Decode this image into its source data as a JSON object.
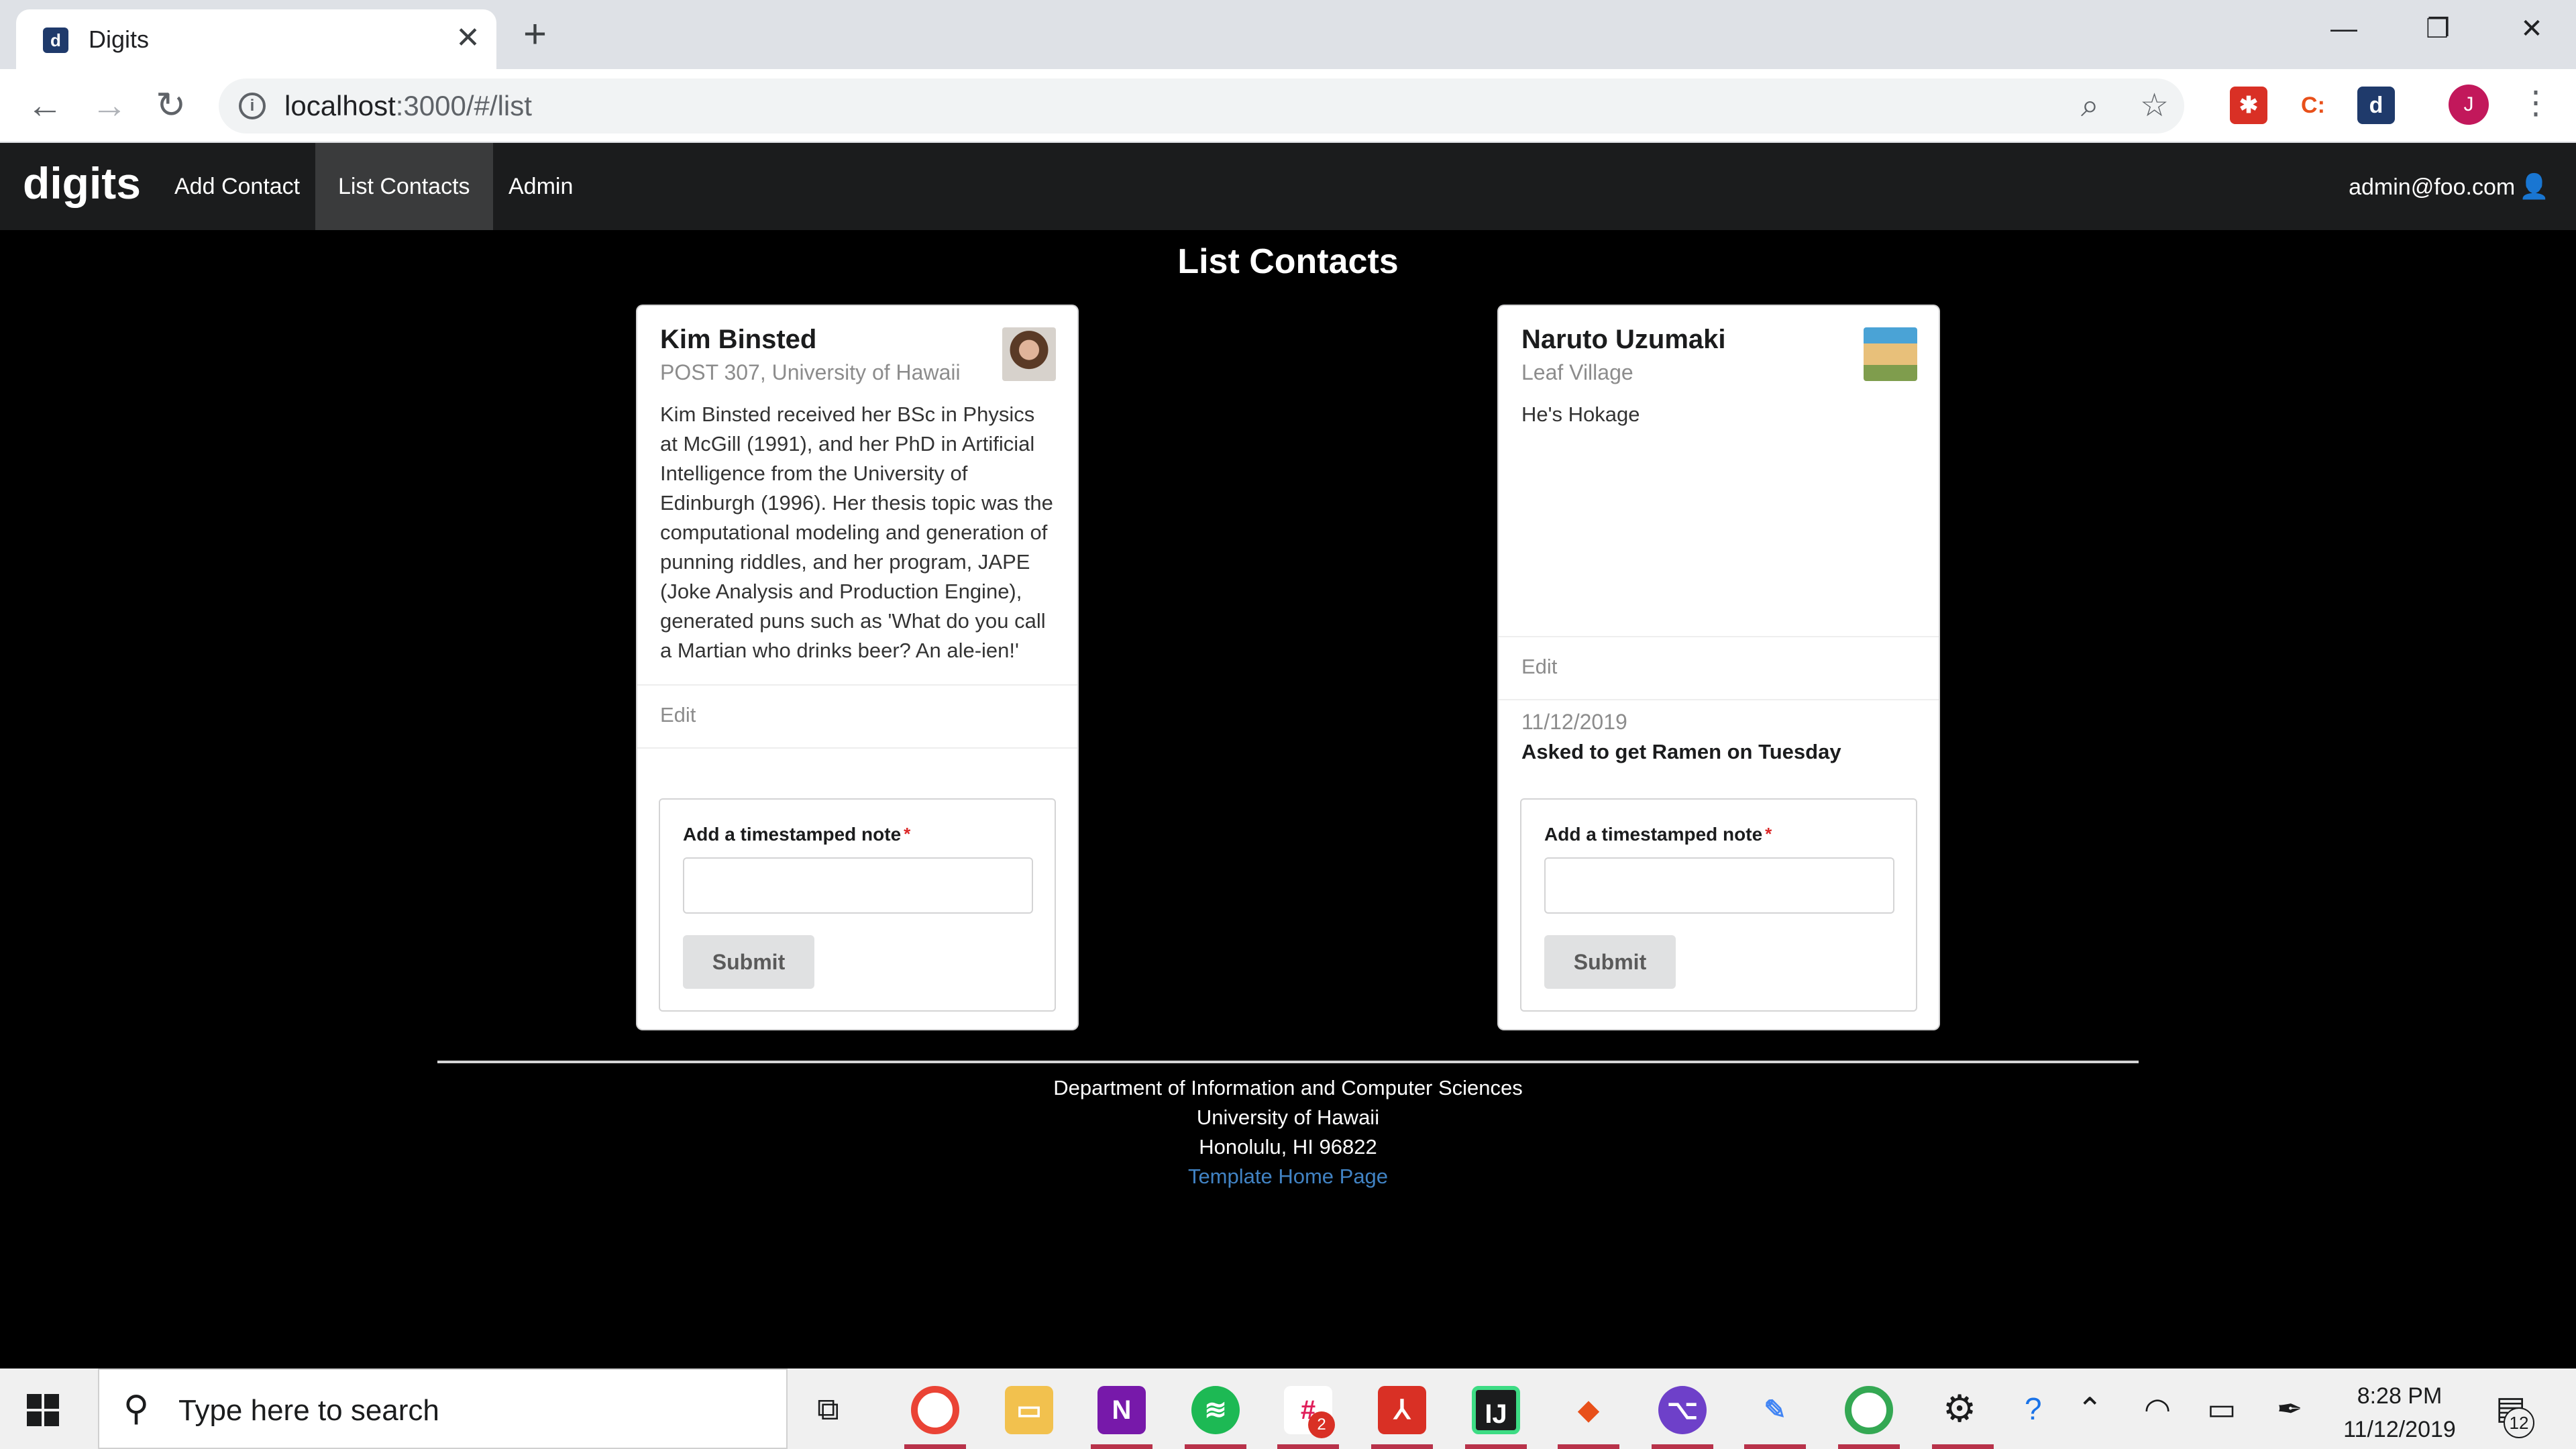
{
  "browser": {
    "tab_title": "Digits",
    "tab_favicon": "digits-favicon",
    "new_tab_glyph": "+",
    "url_host": "localhost",
    "url_path": ":3000/#/list",
    "profile_initial": "J"
  },
  "navbar": {
    "brand": "digits",
    "items": [
      {
        "label": "Add Contact",
        "active": false
      },
      {
        "label": "List Contacts",
        "active": true
      },
      {
        "label": "Admin",
        "active": false
      }
    ],
    "user": "admin@foo.com"
  },
  "page": {
    "title": "List Contacts"
  },
  "contacts": [
    {
      "name": "Kim Binsted",
      "address": "POST 307, University of Hawaii",
      "description": "Kim Binsted received her BSc in Physics at McGill (1991), and her PhD in Artificial Intelligence from the University of Edinburgh (1996). Her thesis topic was the computational modeling and generation of punning riddles, and her program, JAPE (Joke Analysis and Production Engine), generated puns such as 'What do you call a Martian who drinks beer? An ale-ien!'",
      "edit_label": "Edit",
      "notes": [],
      "form": {
        "label": "Add a timestamped note",
        "required_mark": "*",
        "value": "",
        "submit_label": "Submit"
      }
    },
    {
      "name": "Naruto Uzumaki",
      "address": "Leaf Village",
      "description": "He's Hokage",
      "edit_label": "Edit",
      "notes": [
        {
          "date": "11/12/2019",
          "text": "Asked to get Ramen on Tuesday"
        }
      ],
      "form": {
        "label": "Add a timestamped note",
        "required_mark": "*",
        "value": "",
        "submit_label": "Submit"
      }
    }
  ],
  "footer": {
    "line1": "Department of Information and Computer Sciences",
    "line2": "University of Hawaii",
    "line3": "Honolulu, HI 96822",
    "link": "Template Home Page"
  },
  "taskbar": {
    "search_placeholder": "Type here to search",
    "slack_badge": "2",
    "time": "8:28 PM",
    "date": "11/12/2019",
    "notification_count": "12"
  },
  "colors": {
    "page_background": "#000000",
    "navbar_background": "#1b1c1d",
    "active_nav": "#3a3b3c",
    "link": "#4183c4",
    "required": "#db2828"
  }
}
